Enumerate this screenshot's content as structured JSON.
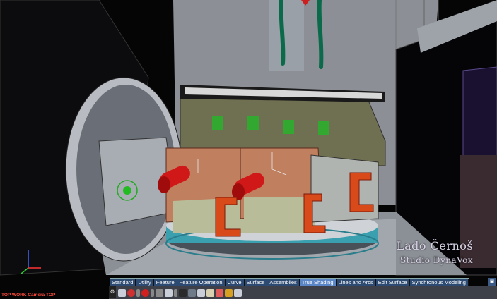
{
  "viewport": {
    "label": "TOP WORK Camera TOP"
  },
  "watermark": {
    "line1": "Lado Černoš",
    "line2": "Studio DynaVox"
  },
  "menu": {
    "tabs": [
      {
        "label": "Standard"
      },
      {
        "label": "Utility"
      },
      {
        "label": "Feature"
      },
      {
        "label": "Feature Operation"
      },
      {
        "label": "Curve"
      },
      {
        "label": "Surface"
      },
      {
        "label": "Assemblies"
      },
      {
        "label": "True Shading",
        "active": true
      },
      {
        "label": "Lines and Arcs"
      },
      {
        "label": "Edit Surface"
      },
      {
        "label": "Synchronous Modeling"
      }
    ]
  },
  "toolbar": {
    "icons": [
      {
        "name": "select-icon",
        "color": "#c9ced8"
      },
      {
        "name": "no-entry-icon",
        "color": "#d03030"
      },
      {
        "name": "dropdown-icon",
        "color": "#888888"
      },
      {
        "name": "record-icon",
        "color": "#d02020"
      },
      {
        "name": "dropdown-icon",
        "color": "#888888"
      },
      {
        "name": "stop-icon",
        "color": "#8a8a8a"
      },
      {
        "name": "shading-icon",
        "color": "#c9ced8"
      },
      {
        "name": "dropdown-icon",
        "color": "#888888"
      },
      {
        "name": "display-icon",
        "color": "#2a2a2a"
      },
      {
        "name": "grid-icon",
        "color": "#6f7a88"
      },
      {
        "name": "view-icon",
        "color": "#c9ced8"
      },
      {
        "name": "layer-icon",
        "color": "#d8d0b0"
      },
      {
        "name": "shape-icon",
        "color": "#e05a5a"
      },
      {
        "name": "magnify-icon",
        "color": "#d8a020"
      },
      {
        "name": "panel-icon",
        "color": "#c9ced8"
      }
    ]
  },
  "colors": {
    "background": "#000000",
    "tab_bar": "#2c4a72",
    "tab_active": "#5a86c8",
    "vise": "#c08060",
    "handle": "#d01818",
    "turntable": "#3aa0b0"
  }
}
